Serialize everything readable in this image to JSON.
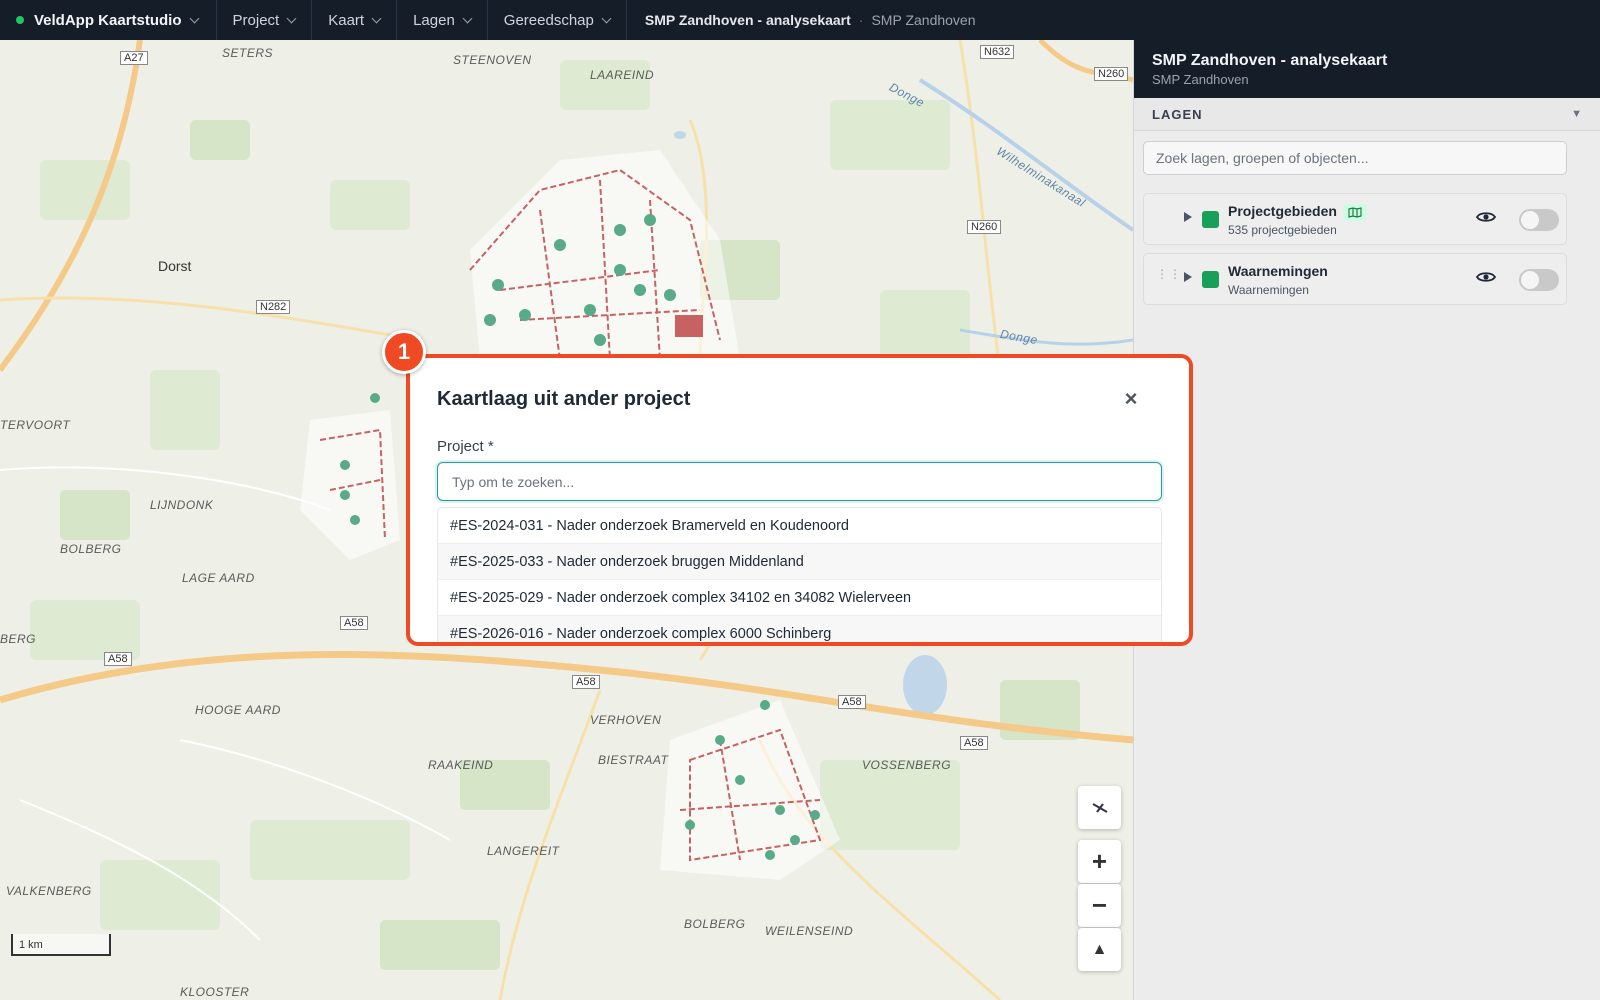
{
  "topbar": {
    "brand": "VeldApp Kaartstudio",
    "menus": [
      "Project",
      "Kaart",
      "Lagen",
      "Gereedschap"
    ],
    "breadcrumb_project": "SMP Zandhoven - analysekaart",
    "breadcrumb_separator": "·",
    "breadcrumb_sub": "SMP Zandhoven"
  },
  "map": {
    "towns": [
      "Dorst"
    ],
    "places": [
      "SETERS",
      "STEENOVEN",
      "LAAREIND",
      "TERVOORT",
      "LIJNDONK",
      "BOLBERG",
      "LAGE AARD",
      "BERG",
      "HOOGE AARD",
      "VERHOVEN",
      "BIESTRAAT",
      "RAAKEIND",
      "VOSSENBERG",
      "LANGEREIT",
      "VALKENBERG",
      "BOLBERG",
      "WEILENSEIND",
      "KLOOSTER"
    ],
    "water_labels": [
      "Donge",
      "Wilhelminakanaal",
      "Donge"
    ],
    "roads": [
      "A27",
      "N632",
      "N260",
      "N260",
      "N282",
      "A58",
      "A58",
      "A58",
      "A58",
      "A58"
    ],
    "scale_label": "1 km",
    "controls": {
      "compass": "compass-icon",
      "zoom_in": "+",
      "zoom_out": "−",
      "north": "▲"
    }
  },
  "panel": {
    "title": "SMP Zandhoven - analysekaart",
    "subtitle": "SMP Zandhoven",
    "layers_header": "LAGEN",
    "collapse_glyph": "▼",
    "search_placeholder": "Zoek lagen, groepen of objecten...",
    "layers": [
      {
        "name": "Projectgebieden",
        "sub": "535 projectgebieden",
        "color": "#18a058",
        "visible": false
      },
      {
        "name": "Waarnemingen",
        "sub": "Waarnemingen",
        "color": "#18a058",
        "visible": false
      }
    ]
  },
  "dialog": {
    "step_number": "1",
    "title": "Kaartlaag uit ander project",
    "close": "×",
    "field_label": "Project *",
    "input_placeholder": "Typ om te zoeken...",
    "options": [
      "#ES-2024-031 - Nader onderzoek Bramerveld en Koudenoord",
      "#ES-2025-033 - Nader onderzoek bruggen Middenland",
      "#ES-2025-029 - Nader onderzoek complex 34102 en 34082 Wielerveen",
      "#ES-2026-016 - Nader onderzoek complex 6000 Schinberg"
    ]
  },
  "colors": {
    "accent": "#ef4a23",
    "teal": "#1aa39a",
    "layer_green": "#18a058",
    "topbar": "#151d29"
  }
}
